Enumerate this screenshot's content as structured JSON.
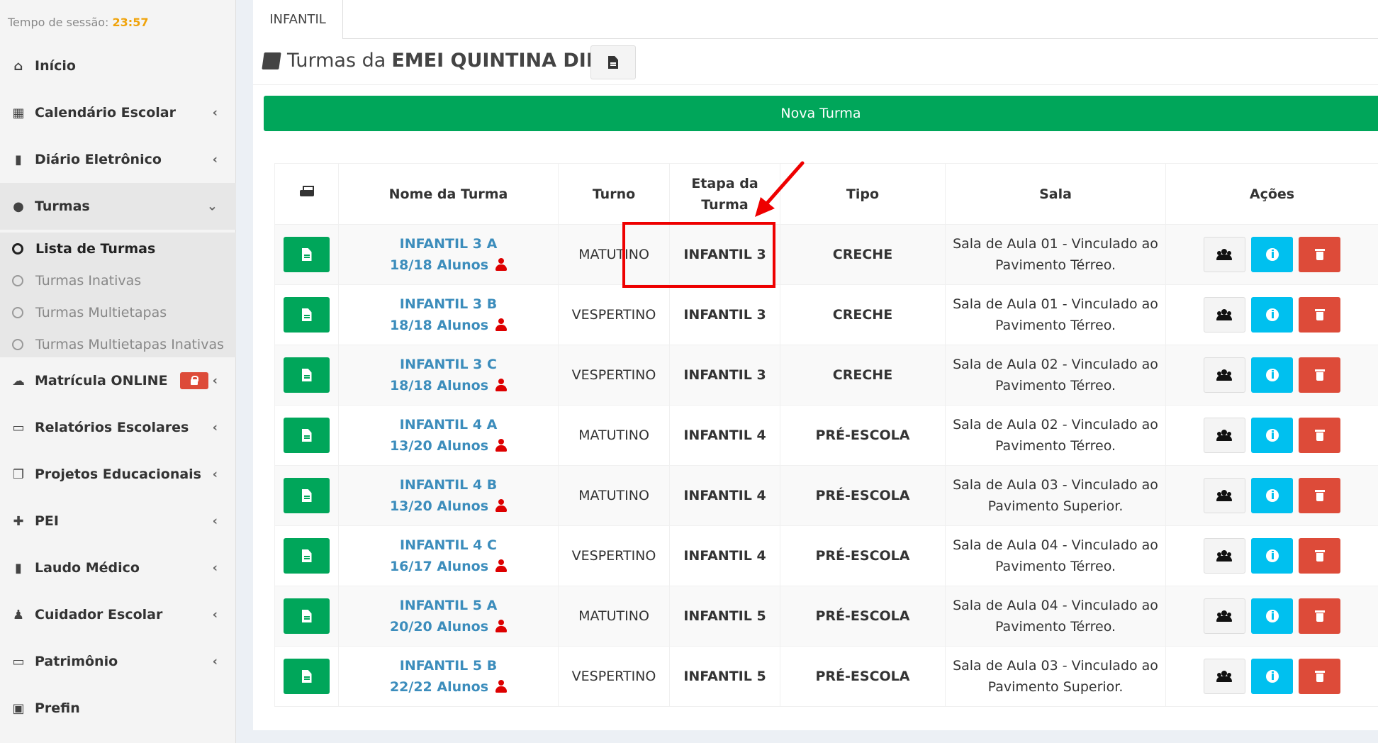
{
  "session": {
    "label": "Tempo de sessão:",
    "time": "23:57"
  },
  "sidebar": {
    "items": [
      {
        "label": "Início",
        "icon": "home-icon",
        "has_chevron": false
      },
      {
        "label": "Calendário Escolar",
        "icon": "calendar-icon",
        "has_chevron": true
      },
      {
        "label": "Diário Eletrônico",
        "icon": "book-icon",
        "has_chevron": true
      },
      {
        "label": "Turmas",
        "icon": "users-icon",
        "has_chevron": true,
        "expanded": true
      },
      {
        "label": "Matrícula ONLINE",
        "icon": "cloud-icon",
        "has_chevron": true,
        "badge": "lock-icon"
      },
      {
        "label": "Relatórios Escolares",
        "icon": "folder-open-icon",
        "has_chevron": true
      },
      {
        "label": "Projetos Educacionais",
        "icon": "copy-icon",
        "has_chevron": true
      },
      {
        "label": "PEI",
        "icon": "user-plus-icon",
        "has_chevron": true
      },
      {
        "label": "Laudo Médico",
        "icon": "file-icon",
        "has_chevron": true
      },
      {
        "label": "Cuidador Escolar",
        "icon": "user-shield-icon",
        "has_chevron": true
      },
      {
        "label": "Patrimônio",
        "icon": "laptop-icon",
        "has_chevron": true
      },
      {
        "label": "Prefin",
        "icon": "money-icon",
        "has_chevron": false
      }
    ],
    "turmas_sub": [
      {
        "label": "Lista de Turmas",
        "current": true
      },
      {
        "label": "Turmas Inativas",
        "current": false
      },
      {
        "label": "Turmas Multietapas",
        "current": false
      },
      {
        "label": "Turmas Multietapas Inativas",
        "current": false
      }
    ]
  },
  "tab": {
    "label": "INFANTIL"
  },
  "page_title": {
    "prefix": "Turmas da",
    "school": "EMEI QUINTINA DINIZ"
  },
  "nova_turma_label": "Nova Turma",
  "table": {
    "headers": [
      "Nome da Turma",
      "Turno",
      "Etapa da Turma",
      "Tipo",
      "Sala",
      "Ações"
    ],
    "rows": [
      {
        "nome": "INFANTIL 3 A",
        "alunos": "18/18 Alunos",
        "turno": "MATUTINO",
        "etapa": "INFANTIL 3",
        "tipo": "CRECHE",
        "sala1": "Sala de Aula 01 - Vinculado ao",
        "sala2": "Pavimento Térreo."
      },
      {
        "nome": "INFANTIL 3 B",
        "alunos": "18/18 Alunos",
        "turno": "VESPERTINO",
        "etapa": "INFANTIL 3",
        "tipo": "CRECHE",
        "sala1": "Sala de Aula 01 - Vinculado ao",
        "sala2": "Pavimento Térreo."
      },
      {
        "nome": "INFANTIL 3 C",
        "alunos": "18/18 Alunos",
        "turno": "VESPERTINO",
        "etapa": "INFANTIL 3",
        "tipo": "CRECHE",
        "sala1": "Sala de Aula 02 - Vinculado ao",
        "sala2": "Pavimento Térreo."
      },
      {
        "nome": "INFANTIL 4 A",
        "alunos": "13/20 Alunos",
        "turno": "MATUTINO",
        "etapa": "INFANTIL 4",
        "tipo": "PRÉ-ESCOLA",
        "sala1": "Sala de Aula 02 - Vinculado ao",
        "sala2": "Pavimento Térreo."
      },
      {
        "nome": "INFANTIL 4 B",
        "alunos": "13/20 Alunos",
        "turno": "MATUTINO",
        "etapa": "INFANTIL 4",
        "tipo": "PRÉ-ESCOLA",
        "sala1": "Sala de Aula 03 - Vinculado ao",
        "sala2": "Pavimento Superior."
      },
      {
        "nome": "INFANTIL 4 C",
        "alunos": "16/17 Alunos",
        "turno": "VESPERTINO",
        "etapa": "INFANTIL 4",
        "tipo": "PRÉ-ESCOLA",
        "sala1": "Sala de Aula 04 - Vinculado ao",
        "sala2": "Pavimento Térreo."
      },
      {
        "nome": "INFANTIL 5 A",
        "alunos": "20/20 Alunos",
        "turno": "MATUTINO",
        "etapa": "INFANTIL 5",
        "tipo": "PRÉ-ESCOLA",
        "sala1": "Sala de Aula 04 - Vinculado ao",
        "sala2": "Pavimento Térreo."
      },
      {
        "nome": "INFANTIL 5 B",
        "alunos": "22/22 Alunos",
        "turno": "VESPERTINO",
        "etapa": "INFANTIL 5",
        "tipo": "PRÉ-ESCOLA",
        "sala1": "Sala de Aula 03 - Vinculado ao",
        "sala2": "Pavimento Superior."
      }
    ]
  },
  "colors": {
    "success": "#00a65a",
    "info": "#00c0ef",
    "danger": "#dd4b39",
    "link": "#3c8dbc",
    "session_time": "#f0a30a"
  }
}
